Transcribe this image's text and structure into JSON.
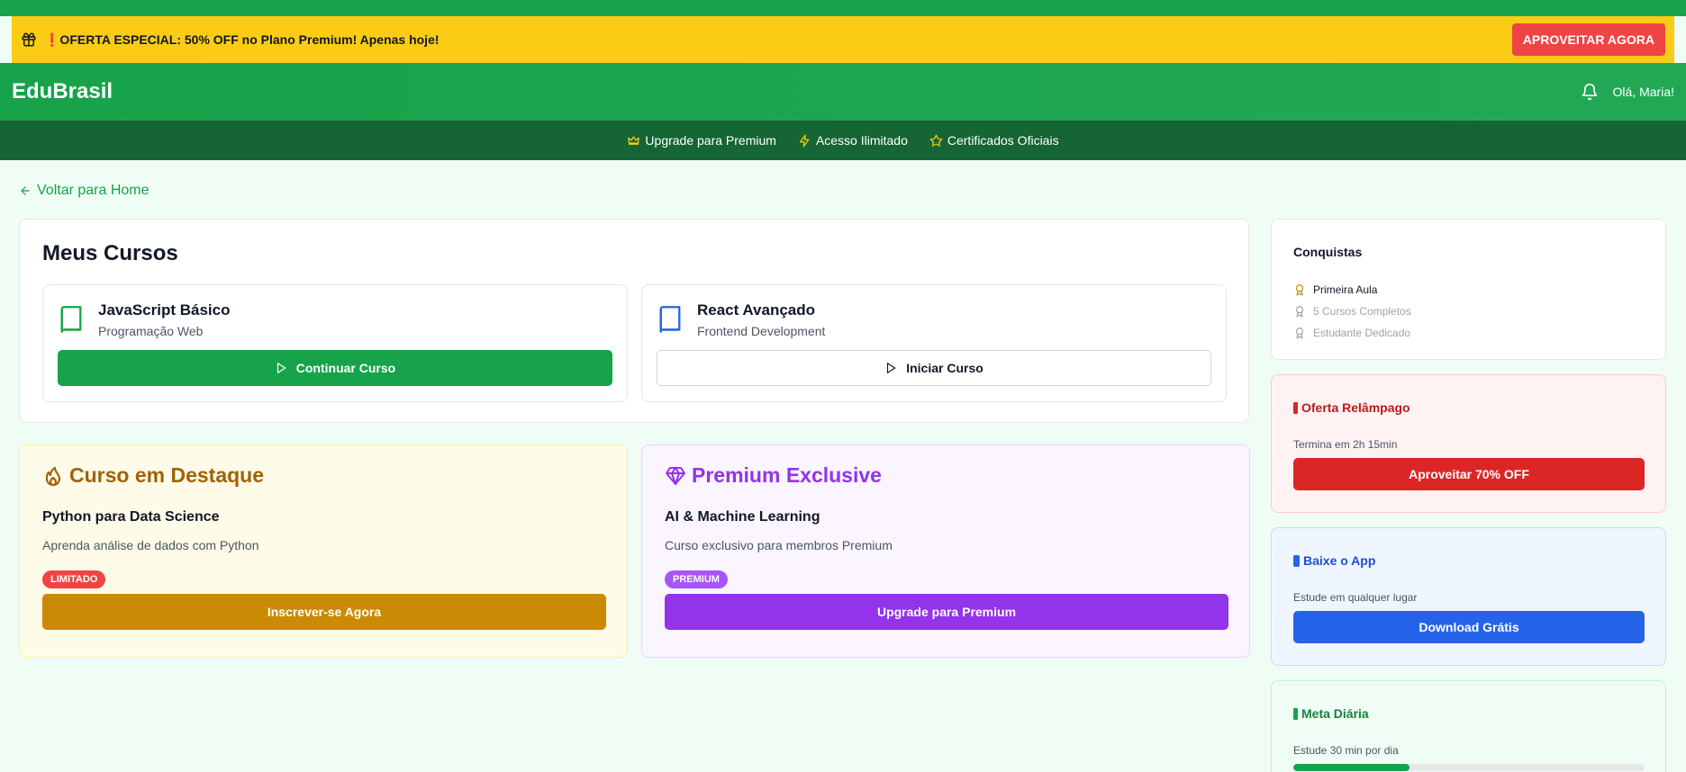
{
  "promo": {
    "text": "❗OFERTA ESPECIAL: 50% OFF no Plano Premium! Apenas hoje!",
    "button": "APROVEITAR AGORA"
  },
  "header": {
    "logo": "EduBrasil",
    "greeting": "Olá, Maria!"
  },
  "subnav": {
    "items": [
      {
        "label": "Upgrade para Premium",
        "icon": "crown-icon"
      },
      {
        "label": "Acesso Ilimitado",
        "icon": "lightning-icon"
      },
      {
        "label": "Certificados Oficiais",
        "icon": "star-icon"
      }
    ]
  },
  "back_link": "Voltar para Home",
  "my_courses": {
    "title": "Meus Cursos",
    "courses": [
      {
        "title": "JavaScript Básico",
        "subtitle": "Programação Web",
        "button": "Continuar Curso",
        "icon_color": "#16a34a"
      },
      {
        "title": "React Avançado",
        "subtitle": "Frontend Development",
        "button": "Iniciar Curso",
        "icon_color": "#2563eb"
      }
    ]
  },
  "featured": {
    "title": "Curso em Destaque",
    "course_name": "Python para Data Science",
    "description": "Aprenda análise de dados com Python",
    "badge": "LIMITADO",
    "button": "Inscrever-se Agora"
  },
  "premium": {
    "title": "Premium Exclusive",
    "course_name": "AI & Machine Learning",
    "description": "Curso exclusivo para membros Premium",
    "badge": "PREMIUM",
    "button": "Upgrade para Premium"
  },
  "achievements": {
    "title": "Conquistas",
    "items": [
      {
        "label": "Primeira Aula",
        "unlocked": true
      },
      {
        "label": "5 Cursos Completos",
        "unlocked": false
      },
      {
        "label": "Estudante Dedicado",
        "unlocked": false
      }
    ]
  },
  "flash_offer": {
    "title": "Oferta Relâmpago",
    "description": "Termina em 2h 15min",
    "button": "Aproveitar 70% OFF"
  },
  "app_download": {
    "title": "Baixe o App",
    "description": "Estude em qualquer lugar",
    "button": "Download Grátis"
  },
  "daily_goal": {
    "title": "Meta Diária",
    "description": "Estude 30 min por dia",
    "progress": 0.33
  },
  "colors": {
    "primary_green": "#16a34a",
    "dark_green": "#166534",
    "promo_yellow": "#facc15",
    "alert_red": "#ef4444",
    "premium_purple": "#9333ea",
    "featured_gold": "#ca8a04",
    "app_blue": "#2563eb"
  }
}
